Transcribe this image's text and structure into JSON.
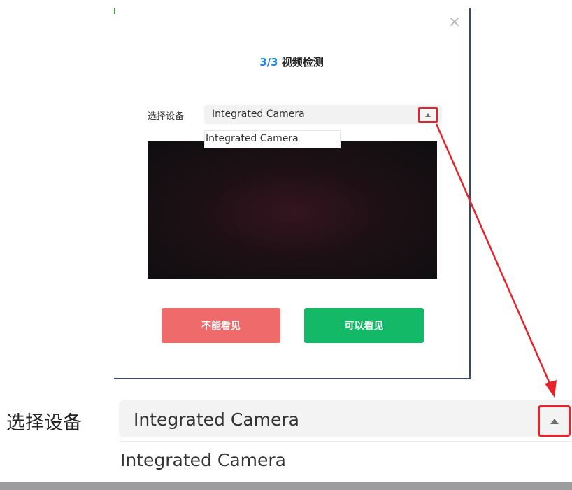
{
  "dialog": {
    "close_symbol": "×",
    "title_step": "3/3",
    "title_name": "视频检测",
    "device_label": "选择设备",
    "selected_device": "Integrated Camera",
    "options": [
      "Integrated Camera"
    ],
    "btn_cannot_see": "不能看见",
    "btn_can_see": "可以看见"
  },
  "zoom": {
    "device_label": "选择设备",
    "selected_device": "Integrated Camera",
    "options": [
      "Integrated Camera"
    ]
  },
  "colors": {
    "title_step": "#1f87e5",
    "btn_cannot_see": "#ef6a6a",
    "btn_can_see": "#14b968",
    "annotation": "#e8222a"
  },
  "icons": {
    "close": "close-icon",
    "dropdown_arrow": "triangle-up-icon"
  }
}
